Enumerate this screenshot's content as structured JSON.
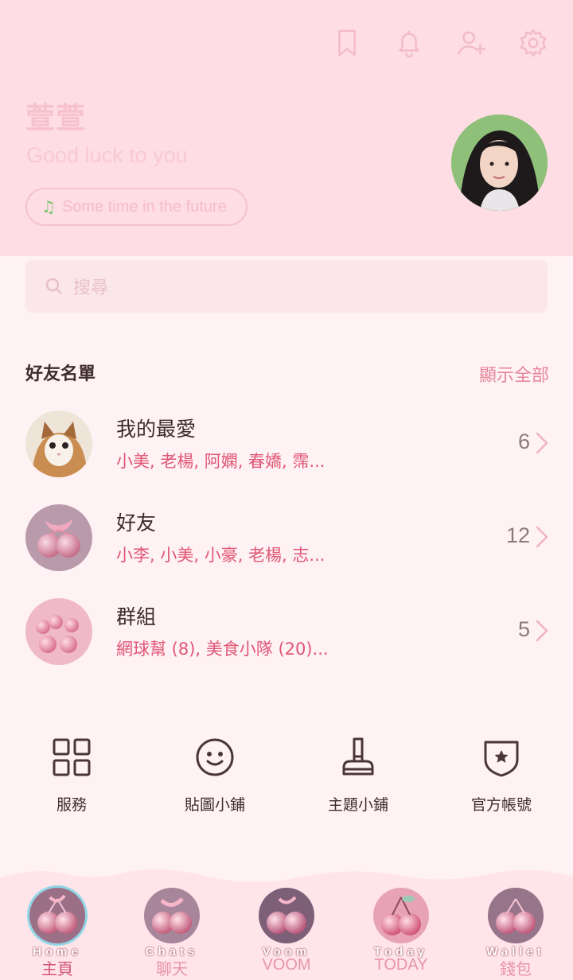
{
  "header": {
    "icons": [
      "bookmark-icon",
      "bell-icon",
      "add-friend-icon",
      "settings-icon"
    ],
    "name": "萱萱",
    "status": "Good luck to you",
    "music": "Some time in the future"
  },
  "search": {
    "placeholder": "搜尋"
  },
  "friends": {
    "section_title": "好友名單",
    "show_all": "顯示全部",
    "rows": [
      {
        "title": "我的最愛",
        "members": "小美, 老楊, 阿嫻, 春嬌, 霈...",
        "count": "6"
      },
      {
        "title": "好友",
        "members": "小李, 小美, 小豪, 老楊, 志...",
        "count": "12"
      },
      {
        "title": "群組",
        "members": "網球幫 (8), 美食小隊 (20)...",
        "count": "5"
      }
    ]
  },
  "shortcuts": [
    {
      "label": "服務",
      "icon": "grid-icon"
    },
    {
      "label": "貼圖小鋪",
      "icon": "smile-icon"
    },
    {
      "label": "主題小鋪",
      "icon": "brush-icon"
    },
    {
      "label": "官方帳號",
      "icon": "shield-star-icon"
    }
  ],
  "nav": [
    {
      "en": "Home",
      "zh": "主頁",
      "active": true
    },
    {
      "en": "Chats",
      "zh": "聊天",
      "active": false
    },
    {
      "en": "Voom",
      "zh": "VOOM",
      "active": false
    },
    {
      "en": "Today",
      "zh": "TODAY",
      "active": false
    },
    {
      "en": "Wallet",
      "zh": "錢包",
      "active": false
    }
  ],
  "colors": {
    "header_bg": "#FFDDE4",
    "body_bg": "#FFF2F4",
    "accent": "#E05675"
  }
}
